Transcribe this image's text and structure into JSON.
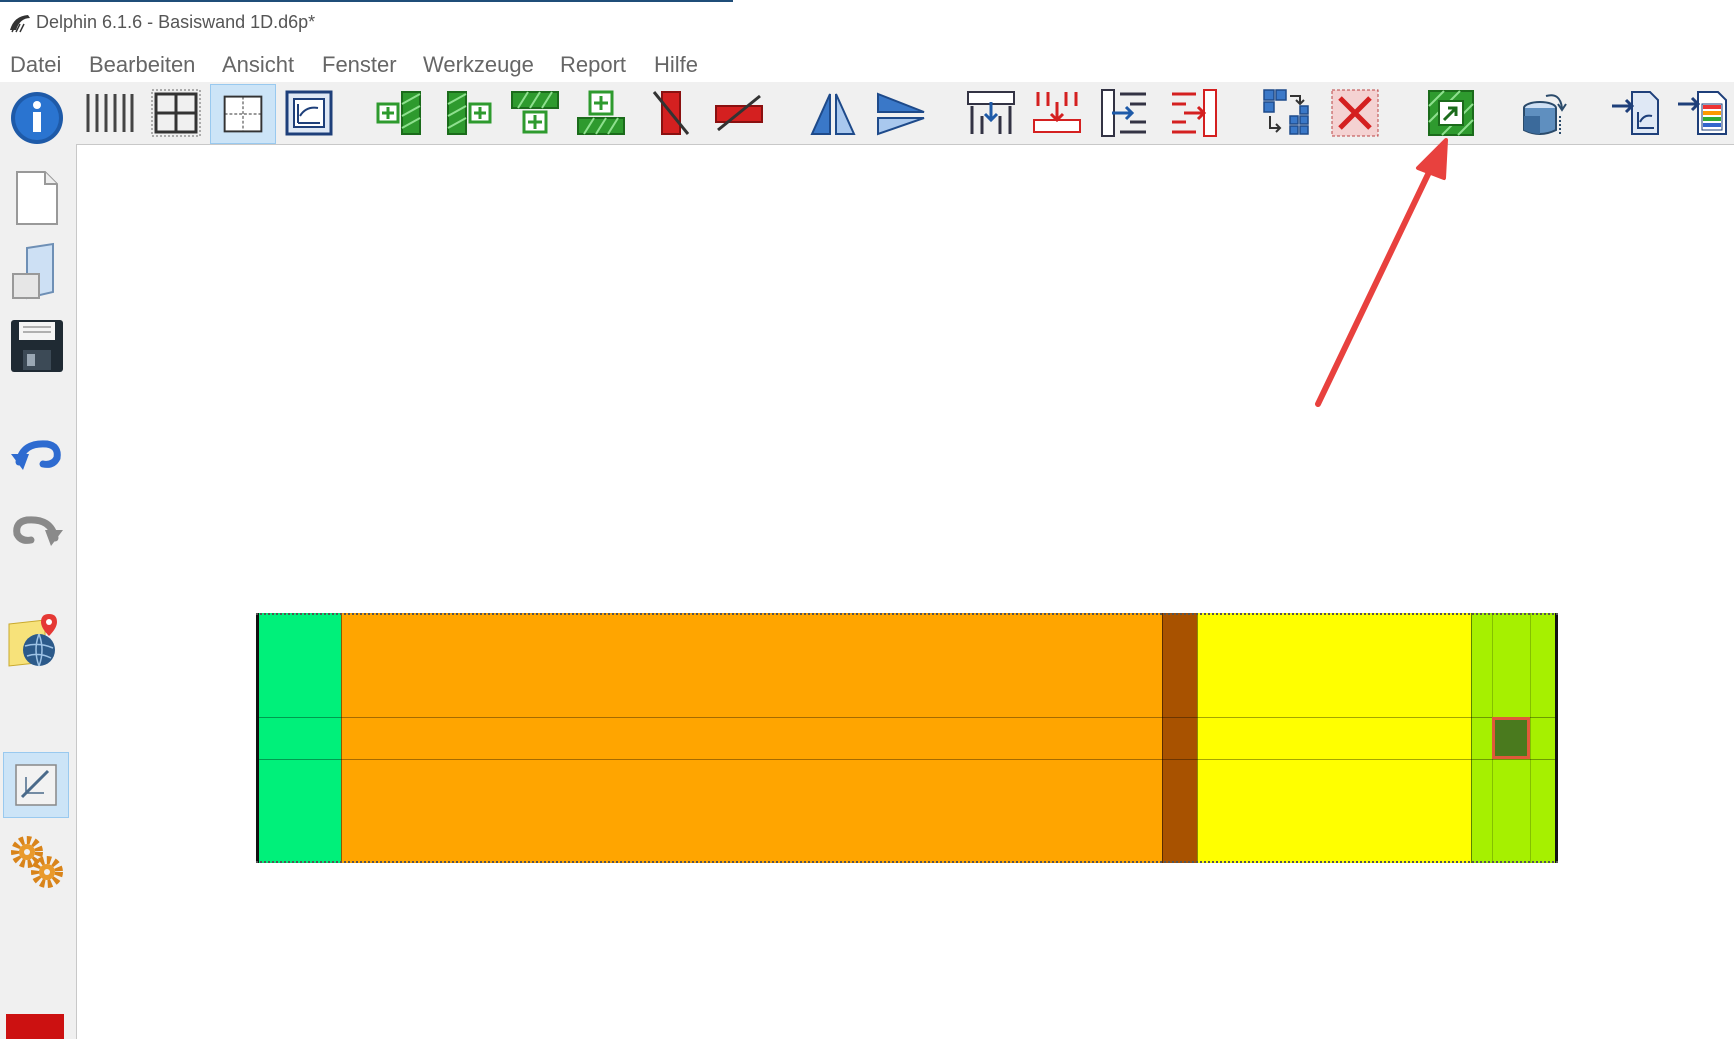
{
  "window": {
    "title": "Delphin 6.1.6 - Basiswand 1D.d6p*"
  },
  "menu": {
    "items": [
      "Datei",
      "Bearbeiten",
      "Ansicht",
      "Fenster",
      "Werkzeuge",
      "Report",
      "Hilfe"
    ]
  },
  "toolbar": {
    "icons": [
      "info-icon",
      "vertical-grid-lines-icon",
      "cell-grid-icon",
      "selection-grid-icon",
      "diagram-view-icon",
      "insert-column-left-icon",
      "insert-column-right-icon",
      "insert-row-above-icon",
      "insert-row-below-icon",
      "delete-column-icon",
      "delete-row-icon",
      "mirror-horizontal-icon",
      "mirror-vertical-icon",
      "split-columns-icon",
      "remove-columns-icon",
      "split-rows-icon",
      "remove-rows-icon",
      "assign-region-icon",
      "delete-assignment-icon",
      "replace-material-icon",
      "rotate-construction-icon",
      "import-construction-icon",
      "import-table-icon"
    ],
    "highlighted": "replace-material-icon"
  },
  "sidebar": {
    "icons": [
      "new-file-icon",
      "open-file-icon",
      "save-icon",
      "undo-icon",
      "redo-icon",
      "location-globe-icon",
      "construction-edit-icon",
      "settings-gears-icon",
      "error-indicator-icon"
    ],
    "active": "construction-edit-icon"
  },
  "construction": {
    "layers": [
      {
        "name": "layer-1",
        "color": "#00f07a"
      },
      {
        "name": "layer-2",
        "color": "#ffa500"
      },
      {
        "name": "layer-3",
        "color": "#a85200"
      },
      {
        "name": "layer-4",
        "color": "#ffff00"
      },
      {
        "name": "layer-5",
        "color": "#a6f000"
      },
      {
        "name": "layer-6",
        "color": "#a6f000"
      },
      {
        "name": "layer-7",
        "color": "#a6f000"
      }
    ],
    "selected_cell_color": "#4a7a1e"
  },
  "annotation": {
    "arrow_color": "#e8413e"
  },
  "colors": {
    "toolbar_bg": "#f0f0f0",
    "active_highlight": "#cce4f7",
    "accent_green": "#2e9a2e",
    "accent_red": "#d42020",
    "accent_blue": "#1e5aa8"
  }
}
